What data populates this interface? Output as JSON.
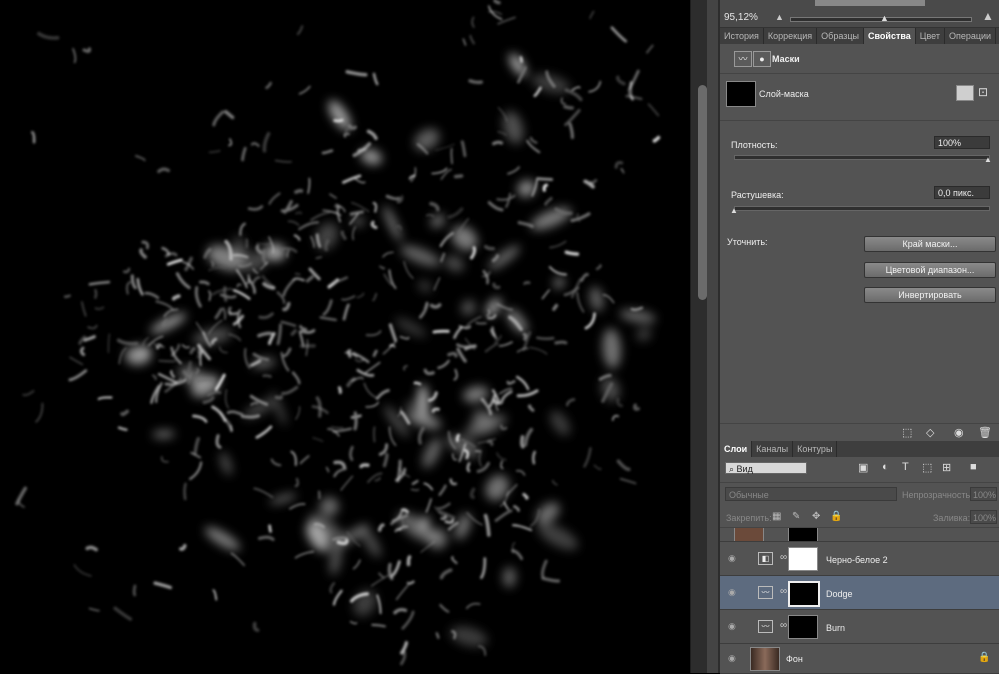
{
  "navigator": {
    "zoom": "95,12%"
  },
  "panel_tabs": [
    "История",
    "Коррекция",
    "Образцы",
    "Свойства",
    "Цвет",
    "Операции"
  ],
  "properties": {
    "title": "Маски",
    "mask_name": "Слой-маска",
    "density_label": "Плотность:",
    "density_value": "100%",
    "density_level": 1.0,
    "feather_label": "Растушевка:",
    "feather_value": "0,0 пикс.",
    "feather_level": 0.0,
    "refine_label": "Уточнить:",
    "buttons": [
      "Край маски...",
      "Цветовой диапазон...",
      "Инвертировать"
    ]
  },
  "layers_tabs": [
    "Слои",
    "Каналы",
    "Контуры"
  ],
  "layers": {
    "filter_kind": "Вид",
    "blend_mode": "Обычные",
    "opacity_label": "Непрозрачность:",
    "opacity_value": "100%",
    "lock_label": "Закрепить:",
    "fill_label": "Заливка:",
    "fill_value": "100%",
    "items": [
      {
        "name": "Черно-белое 2"
      },
      {
        "name": "Dodge"
      },
      {
        "name": "Burn"
      },
      {
        "name": "Фон"
      }
    ]
  },
  "colors": {
    "panel_bg": "#535353",
    "selected_layer": "#5d6b7f",
    "canvas_bg": "#000000"
  }
}
